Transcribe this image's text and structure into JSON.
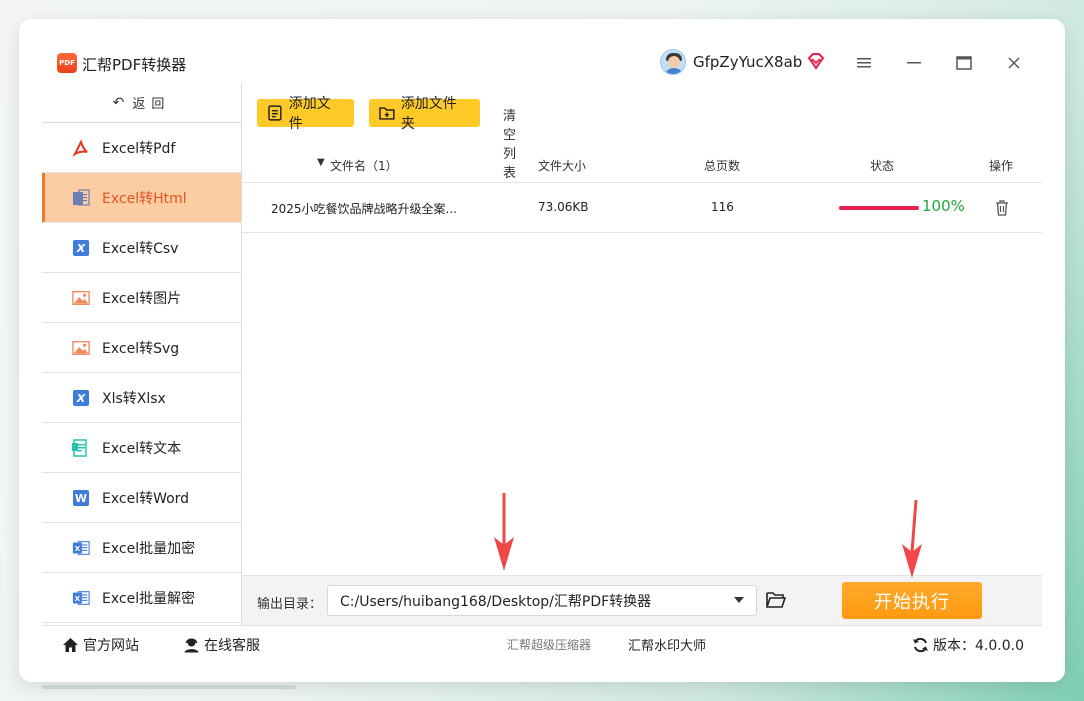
{
  "app": {
    "title": "汇帮PDF转换器",
    "logo_text": "PDF"
  },
  "user": {
    "name": "GfpZyYucX8ab"
  },
  "window_controls": {
    "menu": "≡",
    "minimize": "—",
    "maximize": "☐",
    "close": "✕"
  },
  "sidebar": {
    "back_label": "返回",
    "items": [
      {
        "label": "Excel转Pdf",
        "icon": "pdf-icon",
        "color": "#e8351c"
      },
      {
        "label": "Excel转Html",
        "icon": "html-icon",
        "color": "#6a7fb5",
        "active": true
      },
      {
        "label": "Excel转Csv",
        "icon": "excel-x-icon",
        "color": "#3f7bd8"
      },
      {
        "label": "Excel转图片",
        "icon": "image-icon",
        "color": "#f08a5d"
      },
      {
        "label": "Excel转Svg",
        "icon": "image-icon",
        "color": "#f08a5d"
      },
      {
        "label": "Xls转Xlsx",
        "icon": "excel-x-icon",
        "color": "#3f7bd8"
      },
      {
        "label": "Excel转文本",
        "icon": "text-icon",
        "color": "#23c4b0"
      },
      {
        "label": "Excel转Word",
        "icon": "word-icon",
        "color": "#3f7bd8"
      },
      {
        "label": "Excel批量加密",
        "icon": "excel-lock-icon",
        "color": "#3f7bd8"
      },
      {
        "label": "Excel批量解密",
        "icon": "excel-unlock-icon",
        "color": "#3f7bd8"
      }
    ]
  },
  "toolbar": {
    "add_file": "添加文件",
    "add_folder": "添加文件夹",
    "clear_list": "清空列表"
  },
  "table": {
    "headers": {
      "filename": "文件名（1）",
      "size": "文件大小",
      "pages": "总页数",
      "status": "状态",
      "action": "操作"
    },
    "rows": [
      {
        "filename": "2025小吃餐饮品牌战略升级全案...",
        "size": "73.06KB",
        "pages": "116",
        "progress": 100,
        "progress_label": "100%"
      }
    ]
  },
  "output": {
    "label": "输出目录：",
    "path": "C:/Users/huibang168/Desktop/汇帮PDF转换器"
  },
  "start_button": "开始执行",
  "bottom": {
    "website": "官方网站",
    "support": "在线客服",
    "compressor": "汇帮超级压缩器",
    "watermark": "汇帮水印大师",
    "version": "版本：4.0.0.0"
  },
  "colors": {
    "accent": "#ffc928",
    "start": "#ff9f1a",
    "active_nav": "#fccda2",
    "progress": "#e8204e",
    "success": "#20a83a"
  }
}
